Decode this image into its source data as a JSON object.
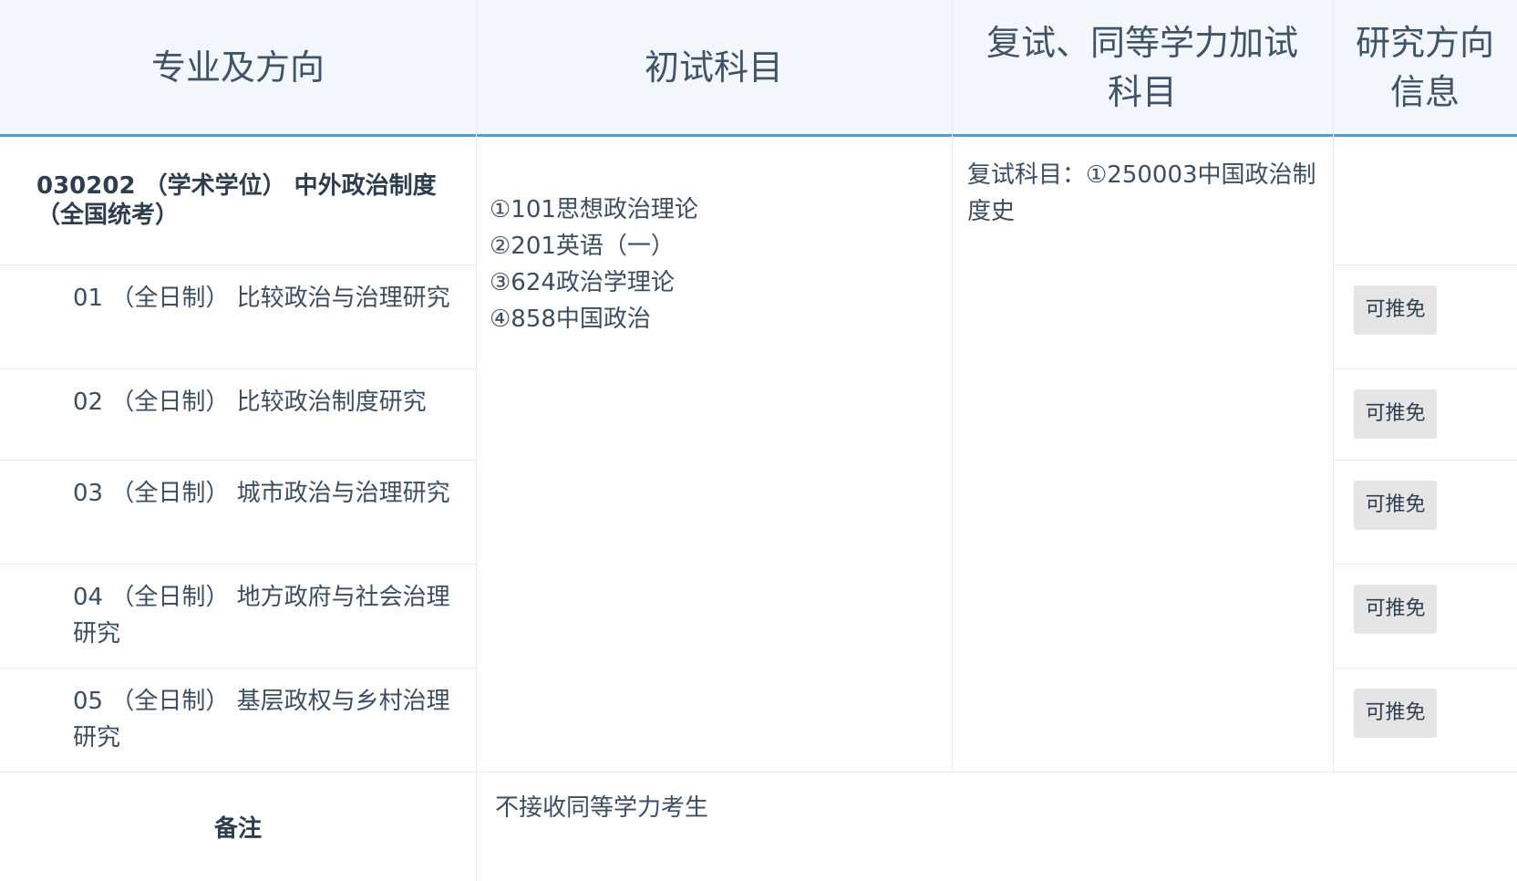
{
  "table": {
    "headers": {
      "major": "专业及方向",
      "initial": "初试科目",
      "retest": "复试、同等学力加试科目",
      "info": "研究方向信息"
    },
    "major": "030202 （学术学位） 中外政治制度 （全国统考）",
    "directions": [
      {
        "label": "01 （全日制） 比较政治与治理研究",
        "badge": "可推免"
      },
      {
        "label": "02 （全日制） 比较政治制度研究",
        "badge": "可推免"
      },
      {
        "label": "03 （全日制） 城市政治与治理研究",
        "badge": "可推免"
      },
      {
        "label": "04 （全日制） 地方政府与社会治理研究",
        "badge": "可推免"
      },
      {
        "label": "05 （全日制） 基层政权与乡村治理研究",
        "badge": "可推免"
      }
    ],
    "initial_subjects": [
      "①101思想政治理论",
      "②201英语（一）",
      "③624政治学理论",
      "④858中国政治"
    ],
    "retest_subjects": "复试科目：①250003中国政治制度史",
    "remark_label": "备注",
    "remark_text": "不接收同等学力考生"
  }
}
